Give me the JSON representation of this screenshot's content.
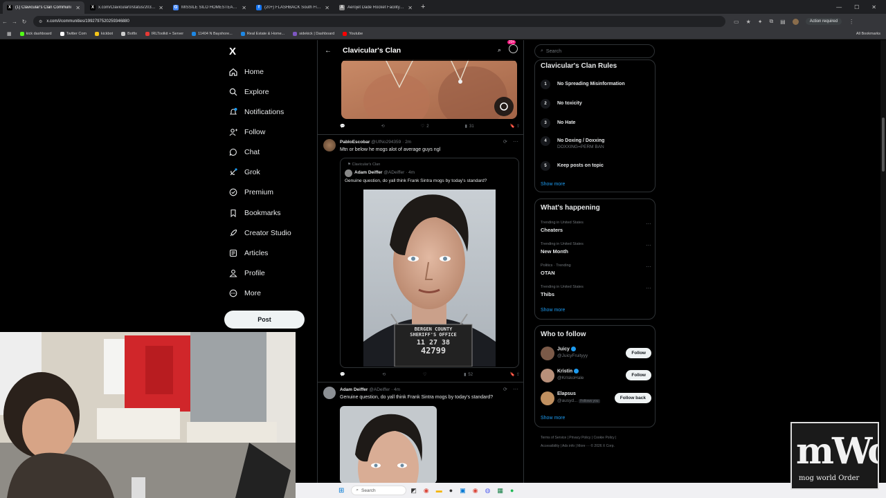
{
  "browser": {
    "tabs": [
      {
        "title": "(1) Clavicular's Clan Communi",
        "fav": "X",
        "favcolor": "#000000"
      },
      {
        "title": "x.com/Clavicular0/status/20391",
        "fav": "X",
        "favcolor": "#000000"
      },
      {
        "title": "MISSILE SILO HOMESTEAD - Ga",
        "fav": "G",
        "favcolor": "#4285f4"
      },
      {
        "title": "(20+) FLASHBACK South Florid",
        "fav": "f",
        "favcolor": "#1877f2"
      },
      {
        "title": "Aerojet Dade Rocket Facility | A",
        "fav": "A",
        "favcolor": "#888888"
      }
    ],
    "new_tab": "+",
    "url": "x.com/i/communities/1992797520259346880",
    "action_required": "Action required",
    "bookmarks": [
      {
        "label": "kick dashboard",
        "color": "#53fc18"
      },
      {
        "label": "Twitter Com",
        "color": "#ffffff"
      },
      {
        "label": "kickbot",
        "color": "#f5c518"
      },
      {
        "label": "Botfix",
        "color": "#cccccc"
      },
      {
        "label": "IRLToolkit + Server",
        "color": "#e53935"
      },
      {
        "label": "11404 N Bayshore...",
        "color": "#1e88e5"
      },
      {
        "label": "Real Estate & Home...",
        "color": "#1e88e5"
      },
      {
        "label": "sidekick | Dashboard",
        "color": "#7e57c2"
      },
      {
        "label": "Youtube",
        "color": "#ff0000"
      }
    ],
    "all_bookmarks": "All Bookmarks"
  },
  "nav": {
    "logo": "X",
    "items": [
      {
        "label": "Home",
        "icon": "home-icon"
      },
      {
        "label": "Explore",
        "icon": "search-icon"
      },
      {
        "label": "Notifications",
        "icon": "bell-icon"
      },
      {
        "label": "Follow",
        "icon": "follow-icon"
      },
      {
        "label": "Chat",
        "icon": "chat-icon"
      },
      {
        "label": "Grok",
        "icon": "grok-icon"
      },
      {
        "label": "Premium",
        "icon": "premium-icon"
      },
      {
        "label": "Bookmarks",
        "icon": "bookmark-icon"
      },
      {
        "label": "Creator Studio",
        "icon": "rocket-icon"
      },
      {
        "label": "Articles",
        "icon": "articles-icon"
      },
      {
        "label": "Profile",
        "icon": "profile-icon"
      },
      {
        "label": "More",
        "icon": "more-icon"
      }
    ],
    "post": "Post"
  },
  "community": {
    "title": "Clavicular's Clan",
    "badge": "20+"
  },
  "feed": {
    "first_actions": {
      "replies": "",
      "reposts": "",
      "likes": "2",
      "views": "31"
    },
    "post1": {
      "name": "PabloEscobar",
      "handle": "@UfNo294359",
      "time": "· 2m",
      "text": "Mtn or below he mogs alot of average guys ngl",
      "quote_context": "Clavicular's Clan",
      "quote_name": "Adam Deiffer",
      "quote_handle": "@ADeiffer",
      "quote_time": "· 4m",
      "quote_text": "Genuine question, do yall think Frank Sintra mogs by today's standard?",
      "placard_line1": "BERGEN COUNTY",
      "placard_line2": "SHERIFF'S OFFICE",
      "placard_line3": "11  27  38",
      "placard_line4": "42799",
      "views": "52"
    },
    "post2": {
      "name": "Adam Deiffer",
      "handle": "@ADeiffer",
      "time": "· 4m",
      "text": "Genuine question, do yall think Frank Sintra mogs by today's standard?"
    }
  },
  "sidebar": {
    "search_placeholder": "Search",
    "rules_title": "Clavicular's Clan Rules",
    "rules": [
      {
        "n": "1",
        "text": "No Spreading Misinformation",
        "sub": ""
      },
      {
        "n": "2",
        "text": "No toxicity",
        "sub": ""
      },
      {
        "n": "3",
        "text": "No Hate",
        "sub": ""
      },
      {
        "n": "4",
        "text": "No Doxing / Doxxing",
        "sub": "DOXXING=PERM BAN"
      },
      {
        "n": "5",
        "text": "Keep posts on topic",
        "sub": ""
      }
    ],
    "show_more": "Show more",
    "happening_title": "What's happening",
    "trends": [
      {
        "context": "Trending in United States",
        "name": "Cheaters"
      },
      {
        "context": "Trending in United States",
        "name": "New Month"
      },
      {
        "context": "Politics · Trending",
        "name": "OTAN"
      },
      {
        "context": "Trending in United States",
        "name": "Thibs"
      }
    ],
    "who_title": "Who to follow",
    "who": [
      {
        "name": "Juicy",
        "handle": "@JuicyFruityyy",
        "button": "Follow",
        "follows_you": ""
      },
      {
        "name": "Kristin",
        "handle": "@KrIskoHale",
        "button": "Follow",
        "follows_you": ""
      },
      {
        "name": "Elapsus",
        "handle": "@ausyd...",
        "button": "Follow back",
        "follows_you": "Follows you"
      }
    ],
    "footer1": "Terms of Service  |  Privacy Policy  |  Cookie Policy  |",
    "footer2": "Accessibility  |  Ads info  |  More ···  © 2026 X Corp."
  },
  "taskbar": {
    "search": "Search"
  },
  "overlay": {
    "logo_text": "mWo",
    "logo_sub": "mog world Order"
  }
}
